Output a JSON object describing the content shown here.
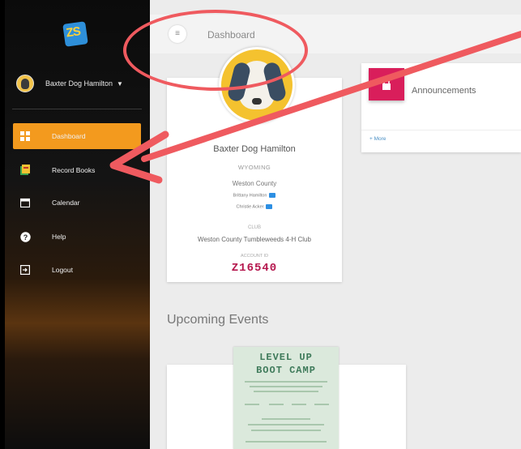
{
  "app": {
    "logo_text": "ZS"
  },
  "sidebar": {
    "user_name": "Baxter Dog Hamilton",
    "items": [
      {
        "label": "Dashboard",
        "icon": "dashboard-icon",
        "active": true
      },
      {
        "label": "Record Books",
        "icon": "record-books-icon",
        "active": false
      },
      {
        "label": "Calendar",
        "icon": "calendar-icon",
        "active": false
      },
      {
        "label": "Help",
        "icon": "help-icon",
        "active": false
      },
      {
        "label": "Logout",
        "icon": "logout-icon",
        "active": false
      }
    ]
  },
  "header": {
    "button": "≡",
    "title": "Dashboard"
  },
  "profile": {
    "name": "Baxter Dog Hamilton",
    "state": "WYOMING",
    "county": "Weston County",
    "contacts": [
      "Brittany Hamilton",
      "Christie Acker"
    ],
    "club_label": "CLUB",
    "club": "Weston County Tumbleweeds 4-H Club",
    "account_label": "ACCOUNT ID",
    "account_id": "Z16540"
  },
  "announcements": {
    "title": "Announcements",
    "more": "+ More"
  },
  "events": {
    "title": "Upcoming Events",
    "poster_title_1": "LEVEL UP",
    "poster_title_2": "BOOT CAMP"
  },
  "colors": {
    "accent": "#f39a1e",
    "announcement": "#d91e5b",
    "annotation": "#ef5a5f",
    "account_id": "#b5174e"
  }
}
